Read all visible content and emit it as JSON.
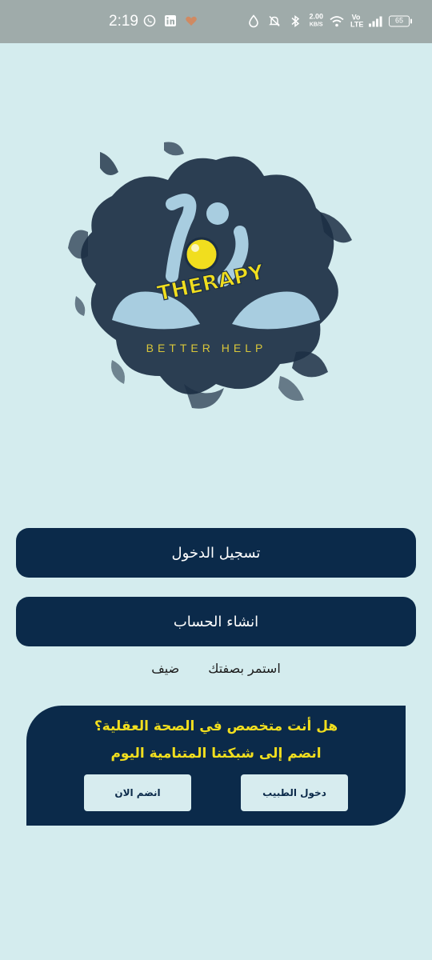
{
  "status_bar": {
    "time": "2:19",
    "net_speed_value": "2.00",
    "net_speed_unit": "KB/S",
    "network_label": "Vo LTE",
    "battery": "65"
  },
  "logo": {
    "wordmark": "THERAPY",
    "tagline": "BETTER HELP"
  },
  "auth": {
    "login_label": "تسجيل الدخول",
    "register_label": "انشاء الحساب"
  },
  "guest": {
    "continue_as": "استمر بصفتك",
    "guest_word": "ضيف"
  },
  "specialist_card": {
    "question": "هل أنت متخصص في الصحة العقلية؟",
    "invite": "انضم إلى شبكتنا المتنامية اليوم",
    "doctor_login_label": "دخول الطبيب",
    "join_now_label": "انضم الان"
  },
  "colors": {
    "background": "#d4ecee",
    "primary": "#0b2a4a",
    "accent": "#f1de1e",
    "status_bar": "#9fabaa"
  }
}
